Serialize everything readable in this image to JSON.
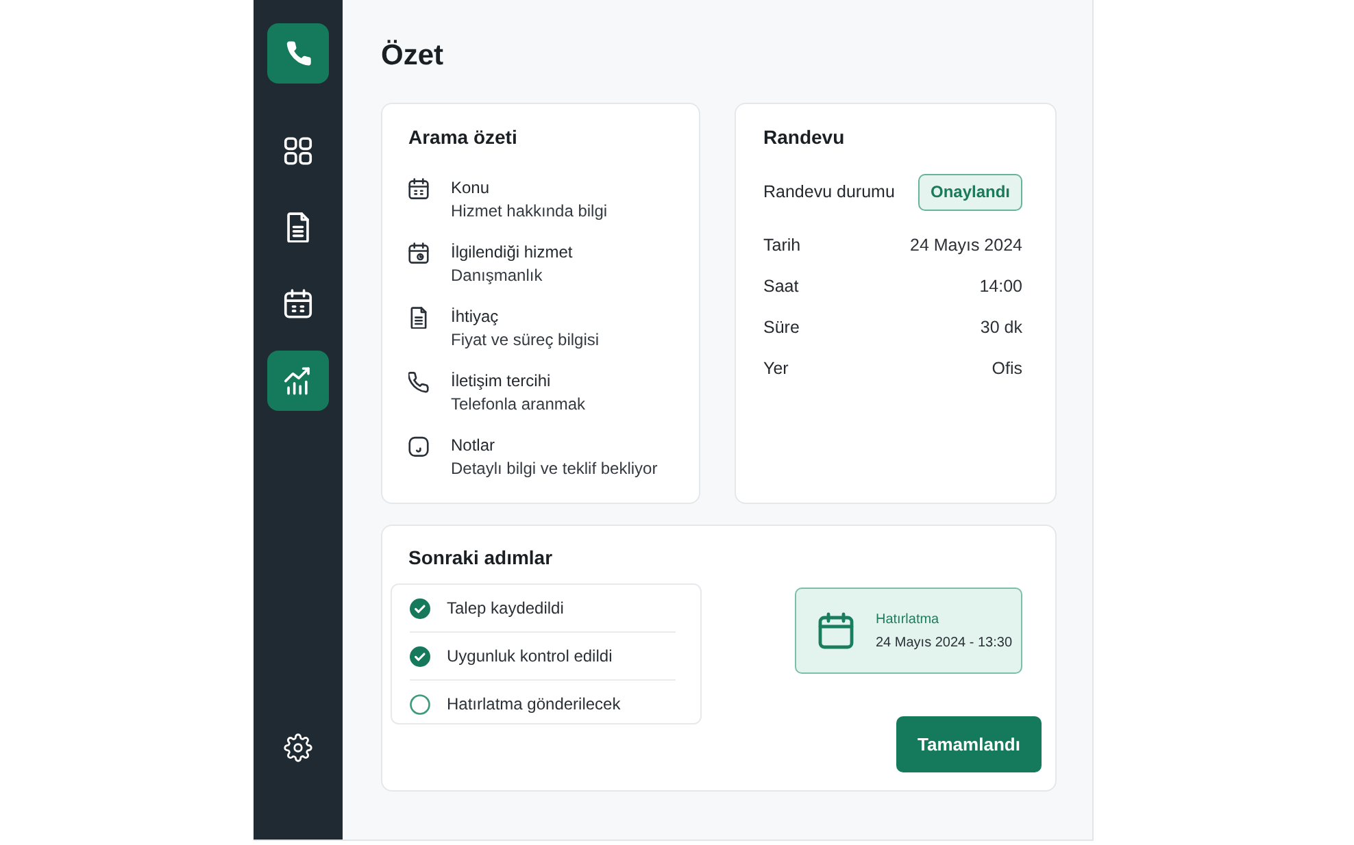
{
  "page": {
    "title": "Özet"
  },
  "sidebar": {
    "items": [
      {
        "kind": "grid",
        "selected": false
      },
      {
        "kind": "document",
        "selected": false
      },
      {
        "kind": "calendar",
        "selected": false
      },
      {
        "kind": "chart",
        "selected": true
      }
    ]
  },
  "call_summary": {
    "title": "Arama özeti",
    "items": [
      {
        "kind": "calendar",
        "label": "Konu",
        "value": "Hizmet hakkında bilgi"
      },
      {
        "kind": "calendar-clock",
        "label": "İlgilendiği hizmet",
        "value": "Danışmanlık"
      },
      {
        "kind": "document",
        "label": "İhtiyaç",
        "value": "Fiyat ve süreç bilgisi"
      },
      {
        "kind": "phone",
        "label": "İletişim tercihi",
        "value": "Telefonla aranmak"
      },
      {
        "kind": "note",
        "label": "Notlar",
        "value": "Detaylı bilgi ve teklif bekliyor"
      }
    ]
  },
  "appointment": {
    "title": "Randevu",
    "rows": [
      {
        "kind": "badge",
        "label": "Randevu durumu",
        "value": "Onaylandı"
      },
      {
        "kind": "text",
        "label": "Tarih",
        "value": "24 Mayıs 2024"
      },
      {
        "kind": "text",
        "label": "Saat",
        "value": "14:00"
      },
      {
        "kind": "text",
        "label": "Süre",
        "value": "30 dk"
      },
      {
        "kind": "text",
        "label": "Yer",
        "value": "Ofis"
      }
    ]
  },
  "next_steps": {
    "title": "Sonraki adımlar",
    "steps": [
      {
        "label": "Talep kaydedildi",
        "checked": true
      },
      {
        "label": "Uygunluk kontrol edildi",
        "checked": true
      },
      {
        "label": "Hatırlatma gönderilecek",
        "checked": false
      }
    ],
    "reminder": {
      "title": "Hatırlatma",
      "value": "24 Mayıs 2024 - 13:30"
    },
    "button": "Tamamlandı"
  }
}
